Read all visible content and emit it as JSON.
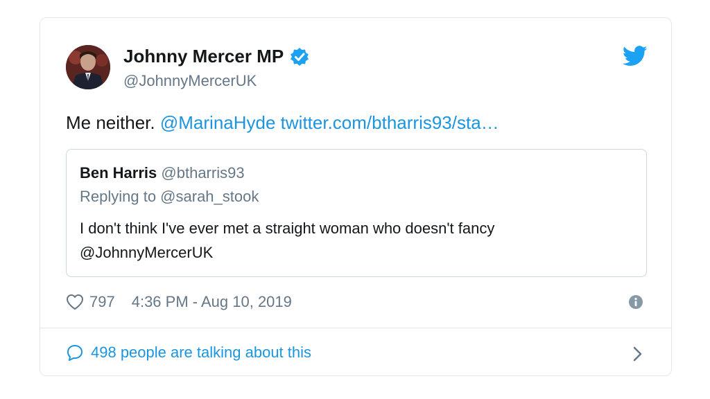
{
  "tweet": {
    "author_name": "Johnny Mercer MP",
    "author_handle": "@JohnnyMercerUK",
    "text_plain": "Me neither.",
    "mention": "@MarinaHyde",
    "url": "twitter.com/btharris93/sta…",
    "likes": "797",
    "timestamp": "4:36 PM - Aug 10, 2019",
    "conversation": "498 people are talking about this"
  },
  "quote": {
    "author_name": "Ben Harris",
    "author_handle": "@btharris93",
    "replying_to": "Replying to @sarah_stook",
    "text": "I don't think I've ever met a straight woman who doesn't fancy @JohnnyMercerUK"
  },
  "colors": {
    "link": "#1b95e0",
    "verified": "#1da1f2",
    "secondary_text": "#657786",
    "border": "#e1e8ed"
  },
  "icons": [
    "verified-badge-icon",
    "twitter-bird-icon",
    "heart-icon",
    "info-icon",
    "speech-bubble-icon",
    "chevron-right-icon"
  ]
}
